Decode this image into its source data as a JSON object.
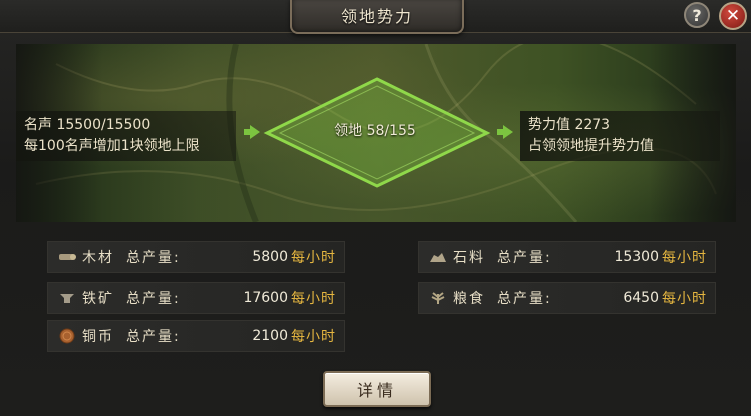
{
  "header": {
    "title": "领地势力",
    "help_label": "?",
    "close_label": "✕"
  },
  "left_info": {
    "fame": "名声 15500/15500",
    "fame_note": "每100名声增加1块领地上限"
  },
  "center": {
    "territory": "领地 58/155"
  },
  "right_info": {
    "power": "势力值 2273",
    "power_note": "占领领地提升势力值"
  },
  "resources": [
    {
      "name": "木材",
      "label": "总产量:",
      "value": "5800",
      "unit": "每小时",
      "icon": "wood-icon"
    },
    {
      "name": "石料",
      "label": "总产量:",
      "value": "15300",
      "unit": "每小时",
      "icon": "stone-icon"
    },
    {
      "name": "铁矿",
      "label": "总产量:",
      "value": "17600",
      "unit": "每小时",
      "icon": "iron-icon"
    },
    {
      "name": "粮食",
      "label": "总产量:",
      "value": "6450",
      "unit": "每小时",
      "icon": "grain-icon"
    },
    {
      "name": "铜币",
      "label": "总产量:",
      "value": "2100",
      "unit": "每小时",
      "icon": "copper-coin-icon"
    }
  ],
  "footer": {
    "details_label": "详情"
  },
  "colors": {
    "accent_green": "#7cc440",
    "unit_gold": "#e5b640",
    "close_red": "#b52a20"
  }
}
